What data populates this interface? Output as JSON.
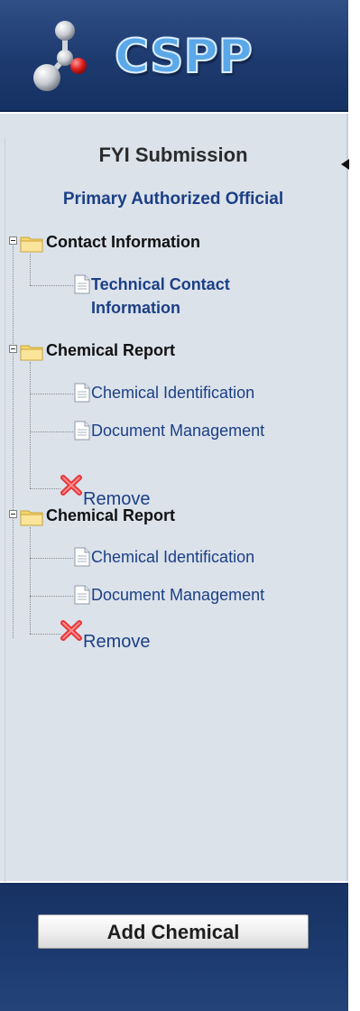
{
  "app": {
    "logo_text": "CSPP"
  },
  "sidebar": {
    "title": "FYI Submission",
    "official_link": "Primary Authorized Official",
    "tree": [
      {
        "label": "Contact Information",
        "children": [
          {
            "label": "Technical Contact Information"
          }
        ]
      },
      {
        "label": "Chemical Report",
        "children": [
          {
            "label": "Chemical Identification"
          },
          {
            "label": "Document Management"
          },
          {
            "label": "Remove",
            "icon": "remove-x-icon"
          }
        ]
      },
      {
        "label": "Chemical Report",
        "children": [
          {
            "label": "Chemical Identification"
          },
          {
            "label": "Document Management"
          },
          {
            "label": "Remove",
            "icon": "remove-x-icon"
          }
        ]
      }
    ]
  },
  "footer": {
    "add_chemical_label": "Add Chemical"
  },
  "colors": {
    "header_blue": "#1d3a6e",
    "panel_bg": "#dbe2ea",
    "link_blue": "#1c3f86",
    "folder_yellow": "#f5d66b",
    "remove_red": "#e8353b"
  }
}
